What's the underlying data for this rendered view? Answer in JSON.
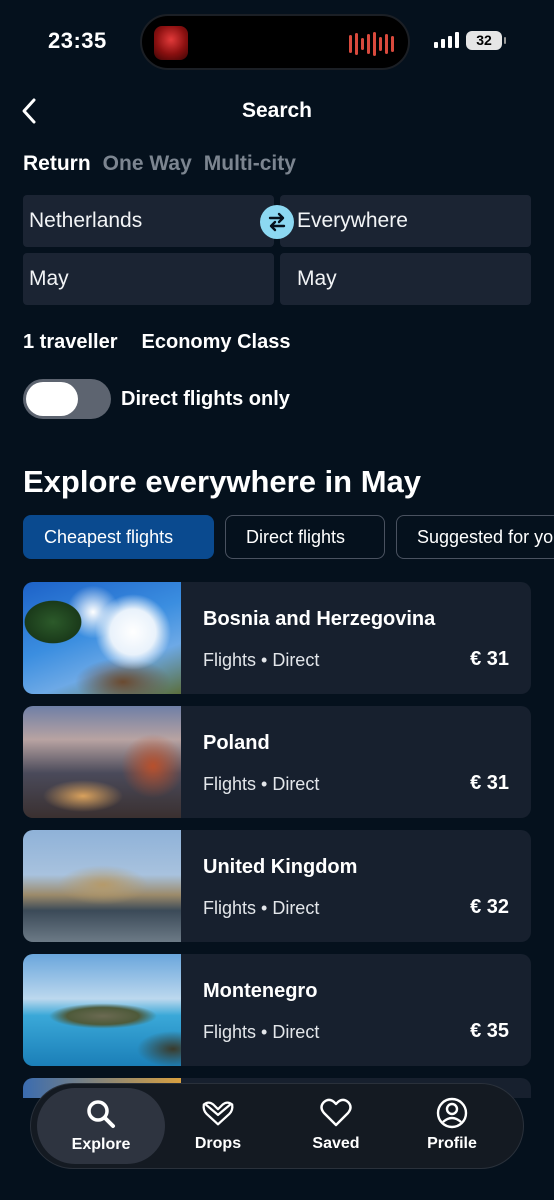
{
  "status_bar": {
    "time": "23:35",
    "battery": "32"
  },
  "header": {
    "title": "Search"
  },
  "trip_types": [
    {
      "label": "Return",
      "active": true
    },
    {
      "label": "One Way",
      "active": false
    },
    {
      "label": "Multi-city",
      "active": false
    }
  ],
  "search": {
    "from": "Netherlands",
    "to": "Everywhere",
    "depart": "May",
    "return": "May",
    "travellers": "1 traveller",
    "cabin": "Economy Class",
    "direct_only_label": "Direct flights only"
  },
  "explore": {
    "title": "Explore everywhere in May",
    "chips": [
      {
        "label": "Cheapest flights",
        "active": true
      },
      {
        "label": "Direct flights",
        "active": false
      },
      {
        "label": "Suggested for you",
        "active": false
      }
    ]
  },
  "results": [
    {
      "destination": "Bosnia and Herzegovina",
      "subtitle": "Flights • Direct",
      "price": "€ 31"
    },
    {
      "destination": "Poland",
      "subtitle": "Flights • Direct",
      "price": "€ 31"
    },
    {
      "destination": "United Kingdom",
      "subtitle": "Flights • Direct",
      "price": "€ 32"
    },
    {
      "destination": "Montenegro",
      "subtitle": "Flights • Direct",
      "price": "€ 35"
    }
  ],
  "bottom_nav": [
    {
      "label": "Explore",
      "icon": "search-icon",
      "active": true
    },
    {
      "label": "Drops",
      "icon": "heart-drop-icon",
      "active": false
    },
    {
      "label": "Saved",
      "icon": "heart-icon",
      "active": false
    },
    {
      "label": "Profile",
      "icon": "profile-icon",
      "active": false
    }
  ],
  "colors": {
    "background": "#05111d",
    "card": "#17202e",
    "accent": "#0a4a8f",
    "swap": "#8cd8f2"
  }
}
